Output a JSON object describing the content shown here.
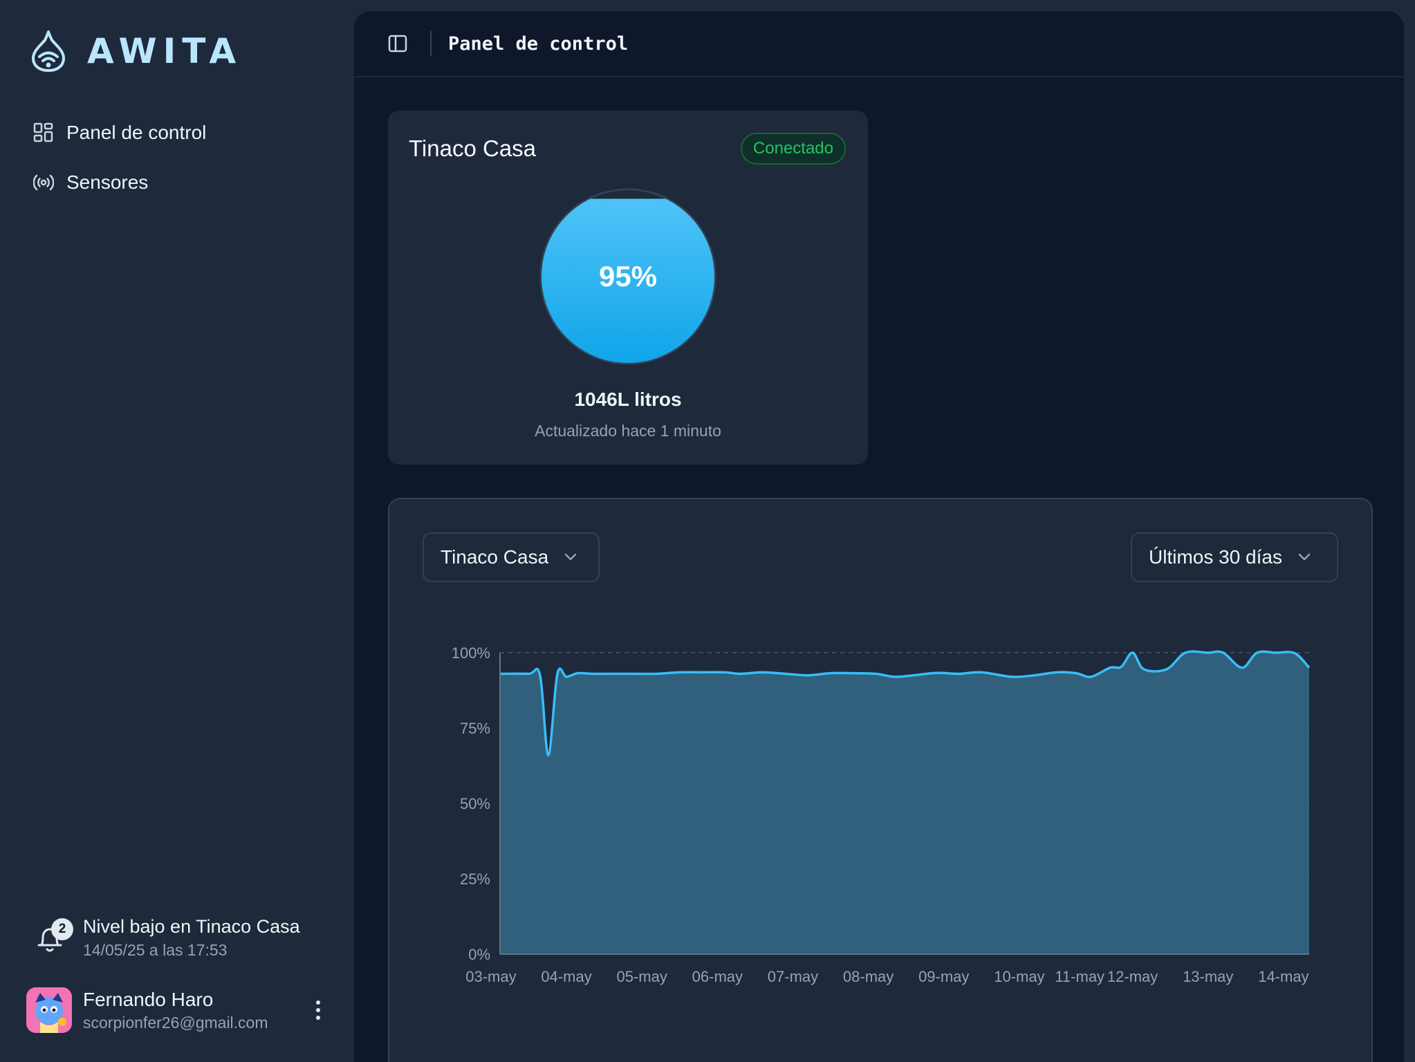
{
  "brand": {
    "name": "AWITA",
    "icon": "water-drop-wifi-icon"
  },
  "sidebar": {
    "items": [
      {
        "label": "Panel de control",
        "icon": "dashboard-icon"
      },
      {
        "label": "Sensores",
        "icon": "broadcast-icon"
      }
    ],
    "notification": {
      "count": "2",
      "title": "Nivel bajo en Tinaco Casa",
      "time": "14/05/25 a las 17:53"
    },
    "user": {
      "name": "Fernando Haro",
      "email": "scorpionfer26@gmail.com"
    }
  },
  "header": {
    "title": "Panel de control"
  },
  "tank": {
    "name": "Tinaco Casa",
    "status": "Conectado",
    "level_percent": 95,
    "level_label": "95%",
    "liters": "1046L litros",
    "updated": "Actualizado hace 1 minuto"
  },
  "filters": {
    "tank_select": "Tinaco Casa",
    "range_select": "Últimos 30 días"
  },
  "colors": {
    "accent": "#38bdf8",
    "success": "#22c55e",
    "area_fill": "#31637f"
  },
  "chart_data": {
    "type": "area",
    "x_tick_labels": [
      "03-may",
      "04-may",
      "05-may",
      "06-may",
      "07-may",
      "08-may",
      "09-may",
      "10-may",
      "11-may",
      "12-may",
      "13-may",
      "14-may"
    ],
    "x_tick_positions": [
      0,
      1,
      2,
      3,
      4,
      5,
      6,
      7,
      7.8,
      8.5,
      9.5,
      10.5
    ],
    "y_tick_labels": [
      "0%",
      "25%",
      "50%",
      "75%",
      "100%"
    ],
    "y_ticks": [
      0,
      25,
      50,
      75,
      100
    ],
    "ylim": [
      0,
      100
    ],
    "xlim": [
      0.12,
      10.84
    ],
    "grid": "dashed horizontal",
    "series": [
      {
        "x": [
          0.12,
          0.5,
          0.65,
          0.76,
          0.88,
          1.0,
          1.15,
          1.35,
          1.6,
          1.9,
          2.2,
          2.5,
          2.8,
          3.1,
          3.3,
          3.6,
          3.9,
          4.2,
          4.5,
          4.8,
          5.1,
          5.35,
          5.6,
          5.9,
          6.2,
          6.5,
          6.9,
          7.2,
          7.5,
          7.75,
          7.95,
          8.2,
          8.35,
          8.5,
          8.65,
          8.95,
          9.2,
          9.5,
          9.7,
          9.95,
          10.15,
          10.4,
          10.65,
          10.84
        ],
        "y": [
          93,
          93,
          92.5,
          66,
          93,
          92,
          93.2,
          93,
          93,
          93,
          93,
          93.5,
          93.5,
          93.5,
          93,
          93.5,
          93,
          92.5,
          93.2,
          93.2,
          93,
          92,
          92.5,
          93.3,
          93,
          93.5,
          92,
          92.5,
          93.5,
          93.2,
          92,
          95,
          95.3,
          100,
          94.5,
          94.5,
          100,
          100,
          100,
          95,
          100,
          100,
          99.8,
          95
        ]
      }
    ]
  }
}
